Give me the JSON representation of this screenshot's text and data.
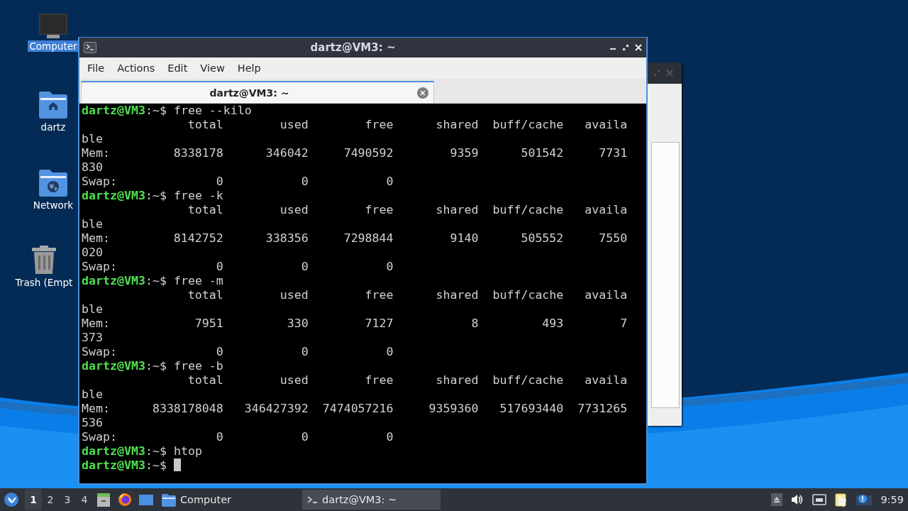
{
  "desktop_icons": [
    {
      "kind": "computer",
      "label": "Computer",
      "selected": true
    },
    {
      "kind": "home-folder",
      "label": "dartz",
      "selected": false
    },
    {
      "kind": "network-folder",
      "label": "Network",
      "selected": false
    },
    {
      "kind": "trash",
      "label": "Trash (Empt",
      "selected": false
    }
  ],
  "window": {
    "title": "dartz@VM3: ~",
    "menu": [
      "File",
      "Actions",
      "Edit",
      "View",
      "Help"
    ],
    "tabs": [
      {
        "label": "dartz@VM3: ~",
        "selected": true
      }
    ],
    "terminal": {
      "lines": [
        {
          "kind": "prompt",
          "user_host": "dartz@VM3",
          "suffix": ":~$",
          "command": "free --kilo"
        },
        {
          "kind": "output",
          "text": "               total        used        free      shared  buff/cache   availa"
        },
        {
          "kind": "output",
          "text": "ble"
        },
        {
          "kind": "output",
          "text": "Mem:         8338178      346042     7490592        9359      501542     7731"
        },
        {
          "kind": "output",
          "text": "830"
        },
        {
          "kind": "output",
          "text": "Swap:              0           0           0"
        },
        {
          "kind": "prompt",
          "user_host": "dartz@VM3",
          "suffix": ":~$",
          "command": "free -k"
        },
        {
          "kind": "output",
          "text": "               total        used        free      shared  buff/cache   availa"
        },
        {
          "kind": "output",
          "text": "ble"
        },
        {
          "kind": "output",
          "text": "Mem:         8142752      338356     7298844        9140      505552     7550"
        },
        {
          "kind": "output",
          "text": "020"
        },
        {
          "kind": "output",
          "text": "Swap:              0           0           0"
        },
        {
          "kind": "prompt",
          "user_host": "dartz@VM3",
          "suffix": ":~$",
          "command": "free -m"
        },
        {
          "kind": "output",
          "text": "               total        used        free      shared  buff/cache   availa"
        },
        {
          "kind": "output",
          "text": "ble"
        },
        {
          "kind": "output",
          "text": "Mem:            7951         330        7127           8         493        7"
        },
        {
          "kind": "output",
          "text": "373"
        },
        {
          "kind": "output",
          "text": "Swap:              0           0           0"
        },
        {
          "kind": "prompt",
          "user_host": "dartz@VM3",
          "suffix": ":~$",
          "command": "free -b"
        },
        {
          "kind": "output",
          "text": "               total        used        free      shared  buff/cache   availa"
        },
        {
          "kind": "output",
          "text": "ble"
        },
        {
          "kind": "output",
          "text": "Mem:      8338178048   346427392  7474057216     9359360   517693440  7731265"
        },
        {
          "kind": "output",
          "text": "536"
        },
        {
          "kind": "output",
          "text": "Swap:              0           0           0"
        },
        {
          "kind": "prompt",
          "user_host": "dartz@VM3",
          "suffix": ":~$",
          "command": "htop"
        },
        {
          "kind": "prompt",
          "user_host": "dartz@VM3",
          "suffix": ":~$",
          "cursor": true
        }
      ]
    }
  },
  "taskbar": {
    "workspaces": [
      {
        "label": "1",
        "selected": true
      },
      {
        "label": "2",
        "selected": false
      },
      {
        "label": "3",
        "selected": false
      },
      {
        "label": "4",
        "selected": false
      }
    ],
    "launchers": [
      {
        "kind": "file-cabinet"
      },
      {
        "kind": "firefox"
      },
      {
        "kind": "desktop"
      }
    ],
    "tasks": [
      {
        "kind": "folder",
        "label": "Computer",
        "selected": false
      },
      {
        "kind": "terminal",
        "label": "dartz@VM3: ~",
        "selected": true
      }
    ],
    "tray": [
      {
        "kind": "eject"
      },
      {
        "kind": "volume"
      },
      {
        "kind": "network"
      },
      {
        "kind": "clipboard"
      },
      {
        "kind": "notification"
      }
    ],
    "clock": "9:59"
  }
}
